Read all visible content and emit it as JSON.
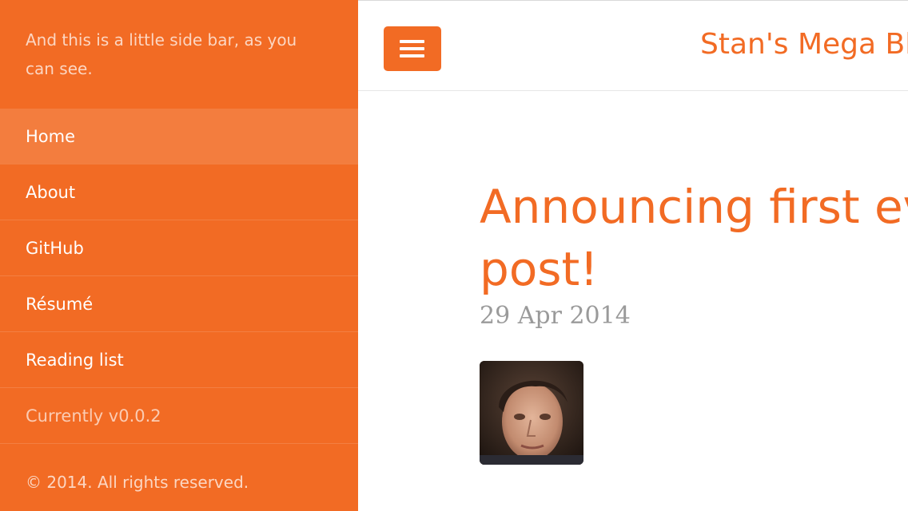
{
  "sidebar": {
    "intro": "And this is a little side bar, as you can see.",
    "items": [
      {
        "label": "Home"
      },
      {
        "label": "About"
      },
      {
        "label": "GitHub"
      },
      {
        "label": "Résumé"
      },
      {
        "label": "Reading list"
      }
    ],
    "version": "Currently v0.0.2",
    "footer": "© 2014. All rights reserved."
  },
  "header": {
    "site_title": "Stan's Mega Blog"
  },
  "post": {
    "title_line1": "Announcing first ever",
    "title_line2": "post!",
    "date": "29 Apr 2014"
  },
  "colors": {
    "accent": "#f26b24",
    "date_gray": "#9a9a9a"
  }
}
